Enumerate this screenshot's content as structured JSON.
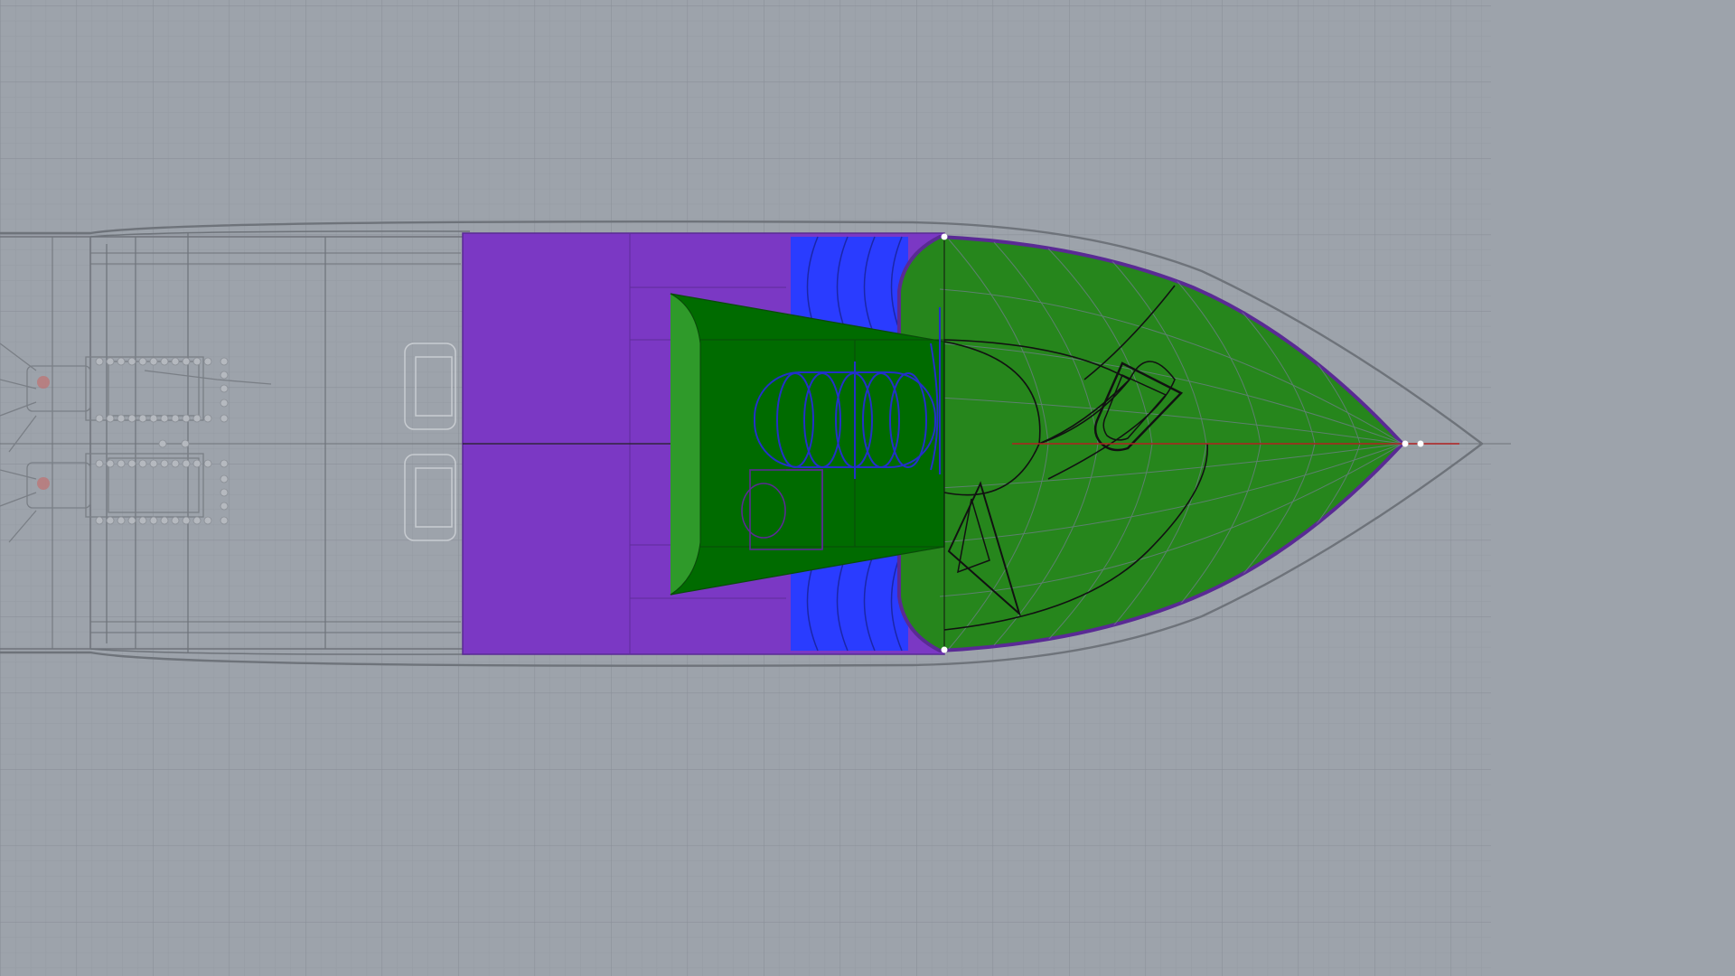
{
  "viewport": {
    "view": "Top",
    "display_mode": "Shaded",
    "colors": {
      "background": "#9da3ab",
      "grid_minor": "#959ba3",
      "grid_major": "#8a9099",
      "world_x_axis": "#b02020",
      "hull_outline": "#6e737a",
      "cockpit_fill": "#7b38c4",
      "deck_fill": "#26861c",
      "recess_fill": "#006b00",
      "cushion_fill": "#2a3cff",
      "curve_blue": "#2330c8",
      "curve_black": "#111111",
      "engine_linework": "#7a7f86",
      "control_point": "#ffffff"
    }
  },
  "objects": [
    {
      "name": "hull",
      "color": "hull_outline"
    },
    {
      "name": "cockpit",
      "color": "cockpit_fill"
    },
    {
      "name": "foredeck",
      "color": "deck_fill"
    },
    {
      "name": "console-recess",
      "color": "recess_fill"
    },
    {
      "name": "bow-cushions",
      "color": "cushion_fill"
    },
    {
      "name": "outboard-engines",
      "color": "engine_linework"
    },
    {
      "name": "bow-hatch",
      "color": "curve_black"
    },
    {
      "name": "anchor-locker",
      "color": "curve_black"
    }
  ]
}
